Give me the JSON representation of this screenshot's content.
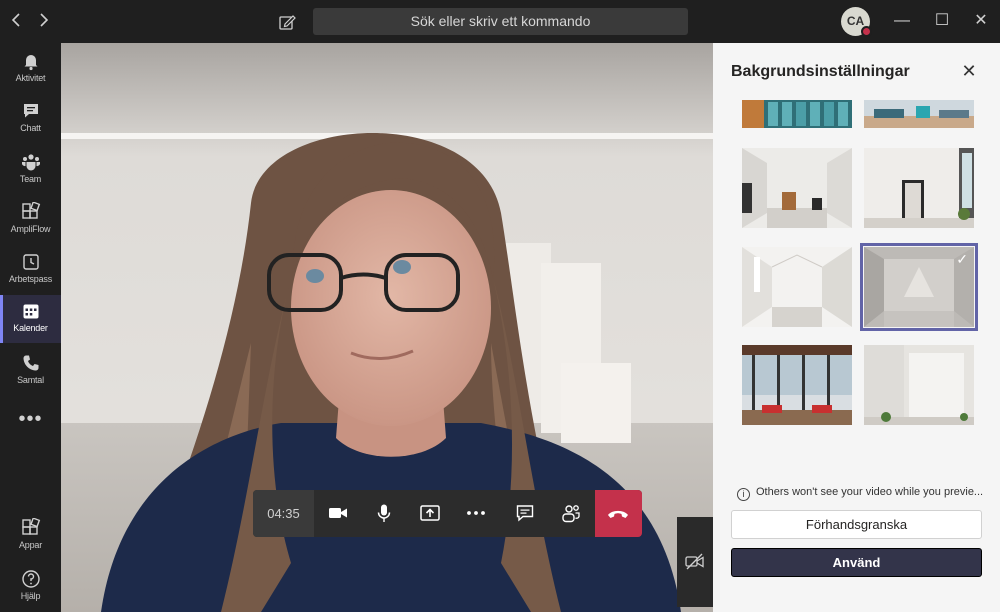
{
  "titlebar": {
    "back_icon": "chevron-left-icon",
    "forward_icon": "chevron-right-icon",
    "search_placeholder": "Sök eller skriv ett kommando",
    "avatar_initials": "CA",
    "presence_color": "#c4314b",
    "minimize": "—",
    "maximize": "☐",
    "close": "✕"
  },
  "rail": {
    "items": [
      {
        "label": "Aktivitet",
        "icon": "bell-icon"
      },
      {
        "label": "Chatt",
        "icon": "chat-icon"
      },
      {
        "label": "Team",
        "icon": "team-icon"
      },
      {
        "label": "AmpliFlow",
        "icon": "apps-icon"
      },
      {
        "label": "Arbetspass",
        "icon": "clock-icon"
      },
      {
        "label": "Kalender",
        "icon": "calendar-icon",
        "active": true
      },
      {
        "label": "Samtal",
        "icon": "phone-icon"
      },
      {
        "label": "Appar",
        "icon": "apps-icon"
      },
      {
        "label": "Hjälp",
        "icon": "help-icon"
      }
    ],
    "more": "•••",
    "accent": "#7f85f5"
  },
  "call": {
    "timer": "04:35",
    "controls": [
      "camera-icon",
      "microphone-icon",
      "share-screen-icon",
      "more-icon",
      "chat-icon",
      "participants-icon",
      "hangup-icon"
    ],
    "hangup_color": "#c4314b"
  },
  "panel": {
    "title": "Bakgrundsinställningar",
    "close": "✕",
    "notice": "Others won't see your video while you previe...",
    "preview_button": "Förhandsgranska",
    "apply_button": "Använd",
    "selected_index": 3,
    "accent": "#6264a7"
  }
}
